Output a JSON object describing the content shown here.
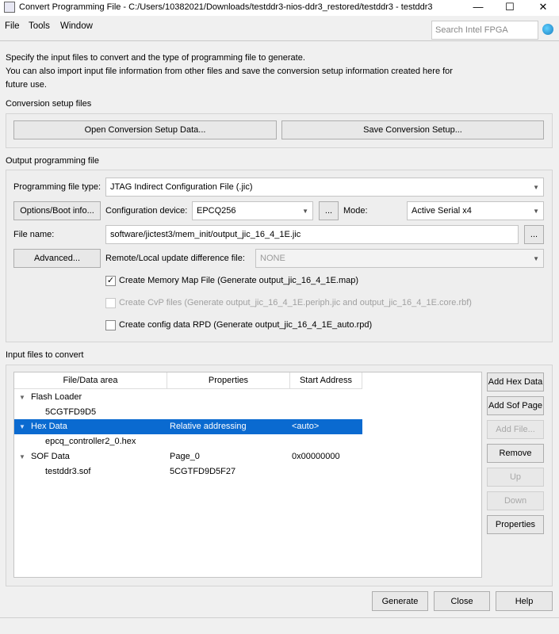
{
  "window": {
    "title": "Convert Programming File - C:/Users/10382021/Downloads/testddr3-nios-ddr3_restored/testddr3 - testddr3",
    "minimize": "—",
    "maximize": "☐",
    "close": "✕"
  },
  "menu": {
    "file": "File",
    "tools": "Tools",
    "window": "Window"
  },
  "search": {
    "placeholder": "Search Intel FPGA"
  },
  "description": {
    "line1": "Specify the input files to convert and the type of programming file to generate.",
    "line2": "You can also import input file information from other files and save the conversion setup information created here for",
    "line3": "future use."
  },
  "setup": {
    "heading": "Conversion setup files",
    "open": "Open Conversion Setup Data...",
    "save": "Save Conversion Setup..."
  },
  "output": {
    "heading": "Output programming file",
    "type_label": "Programming file type:",
    "type_value": "JTAG Indirect Configuration File (.jic)",
    "options_button": "Options/Boot info...",
    "device_label": "Configuration device:",
    "device_value": "EPCQ256",
    "browse": "...",
    "mode_label": "Mode:",
    "mode_value": "Active Serial x4",
    "file_label": "File name:",
    "file_value": "software/jictest3/mem_init/output_jic_16_4_1E.jic",
    "advanced_button": "Advanced...",
    "remote_label": "Remote/Local update difference file:",
    "remote_value": "NONE",
    "checkboxes": [
      {
        "label": "Create Memory Map File (Generate output_jic_16_4_1E.map)",
        "checked": true,
        "enabled": true
      },
      {
        "label": "Create CvP files (Generate output_jic_16_4_1E.periph.jic and output_jic_16_4_1E.core.rbf)",
        "checked": false,
        "enabled": false
      },
      {
        "label": "Create config data RPD (Generate output_jic_16_4_1E_auto.rpd)",
        "checked": false,
        "enabled": true
      }
    ]
  },
  "input": {
    "heading": "Input files to convert",
    "columns": [
      "File/Data area",
      "Properties",
      "Start Address"
    ],
    "rows": [
      {
        "name": "Flash Loader",
        "props": "",
        "addr": ""
      },
      {
        "name": "5CGTFD9D5",
        "props": "",
        "addr": ""
      },
      {
        "name": "Hex Data",
        "props": "Relative addressing",
        "addr": "<auto>"
      },
      {
        "name": "epcq_controller2_0.hex",
        "props": "",
        "addr": ""
      },
      {
        "name": "SOF Data",
        "props": "Page_0",
        "addr": "0x00000000"
      },
      {
        "name": "testddr3.sof",
        "props": "5CGTFD9D5F27",
        "addr": ""
      }
    ],
    "buttons": {
      "add_hex": "Add Hex Data",
      "add_sof": "Add Sof Page",
      "add_file": "Add File...",
      "remove": "Remove",
      "up": "Up",
      "down": "Down",
      "properties": "Properties"
    }
  },
  "footer": {
    "generate": "Generate",
    "close": "Close",
    "help": "Help"
  }
}
